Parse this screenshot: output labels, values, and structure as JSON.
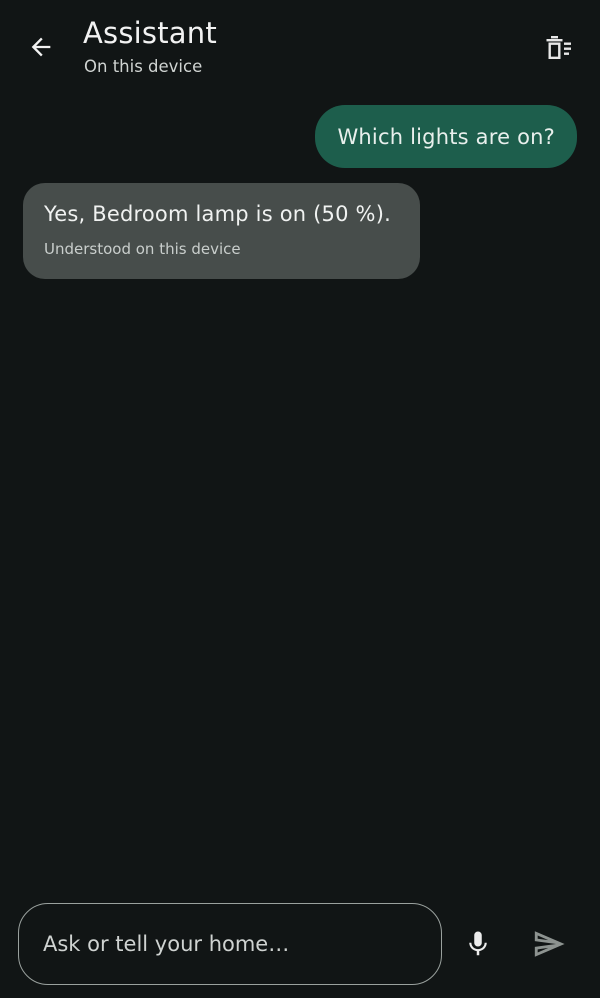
{
  "header": {
    "title": "Assistant",
    "subtitle": "On this device",
    "back_icon": "arrow-left-icon",
    "clear_icon": "delete-sweep-icon"
  },
  "conversation": {
    "messages": [
      {
        "role": "user",
        "text": "Which lights are on?"
      },
      {
        "role": "assistant",
        "text": "Yes, Bedroom lamp is on (50 %).",
        "meta": "Understood on this device"
      }
    ]
  },
  "composer": {
    "placeholder": "Ask or tell your home…",
    "value": "",
    "mic_icon": "microphone-icon",
    "send_icon": "send-icon"
  },
  "colors": {
    "background": "#111515",
    "user_bubble": "#1d5e4c",
    "assistant_bubble": "#474d4b",
    "input_border": "#9aa19e"
  }
}
